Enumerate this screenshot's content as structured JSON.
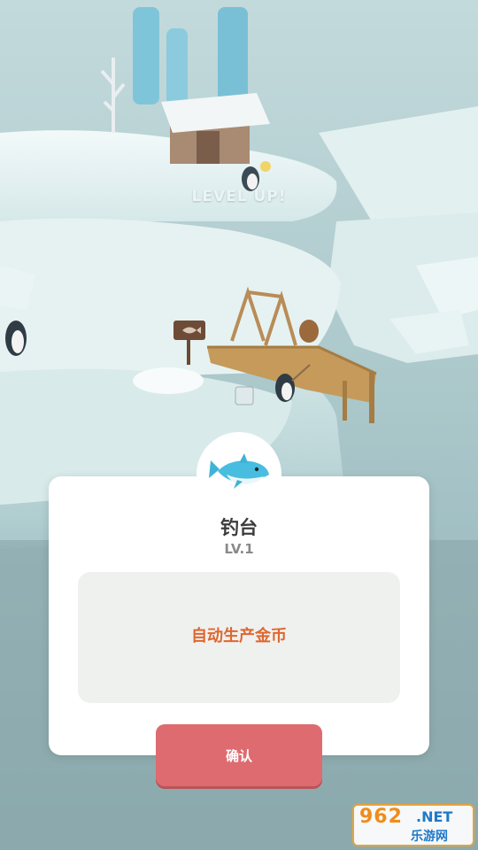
{
  "scene": {
    "level_up_text": "LEVEL UP!",
    "environment": "snowy-island",
    "colors": {
      "ice": "#e6f2f2",
      "sky": "#b8d3d6",
      "wood": "#c59a5a"
    }
  },
  "dialog": {
    "icon": "dolphin-icon",
    "title": "钓台",
    "level": "LV.1",
    "description": "自动生产金币",
    "confirm_label": "确认",
    "colors": {
      "accent": "#de6b70",
      "description": "#e0662e"
    }
  },
  "watermark": {
    "brand": "962",
    "suffix": ".NET",
    "subtitle": "乐游网"
  }
}
